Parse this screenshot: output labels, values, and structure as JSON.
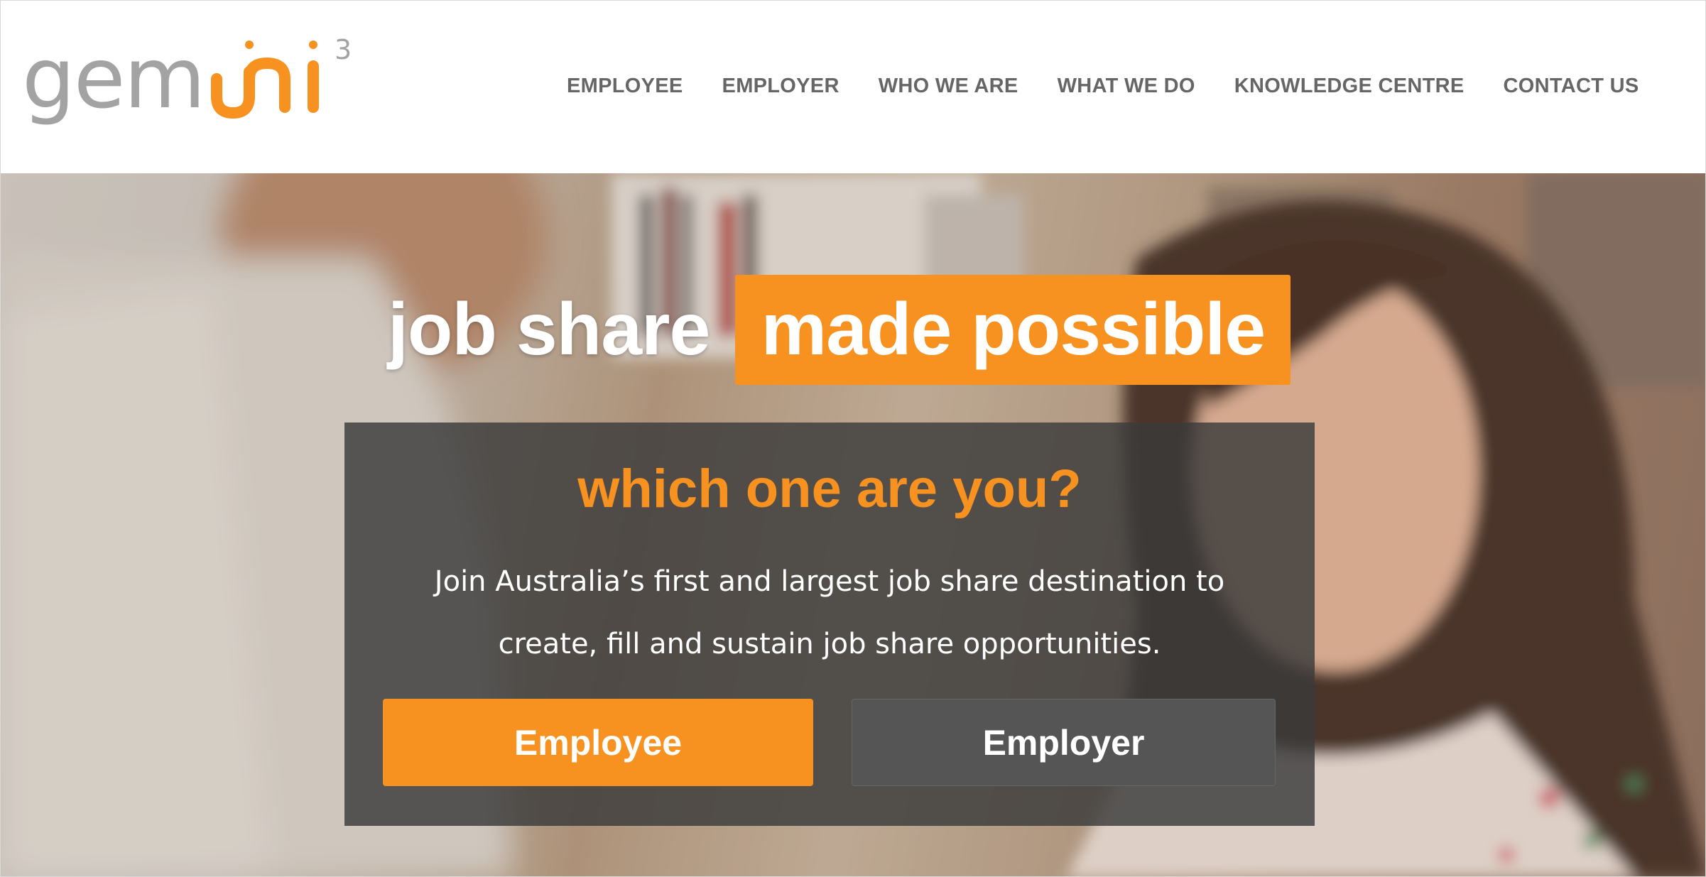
{
  "logo": {
    "text": "gemini",
    "superscript": "3",
    "colors": {
      "gray": "#a3a3a3",
      "orange": "#f7911f"
    }
  },
  "nav": {
    "items": [
      {
        "label": "EMPLOYEE"
      },
      {
        "label": "EMPLOYER"
      },
      {
        "label": "WHO WE ARE"
      },
      {
        "label": "WHAT WE DO"
      },
      {
        "label": "KNOWLEDGE CENTRE"
      },
      {
        "label": "CONTACT US"
      }
    ]
  },
  "hero": {
    "headline_plain": "job share",
    "headline_highlight": "made possible",
    "panel_title": "which one are you?",
    "panel_text": "Join Australia’s first and largest job share destination to create, fill and sustain job share opportunities.",
    "buttons": {
      "employee_label": "Employee",
      "employer_label": "Employer"
    }
  },
  "colors": {
    "accent": "#f7911f",
    "nav_text": "#666666",
    "panel_bg": "#3a3a3a",
    "secondary_button": "#555555"
  }
}
